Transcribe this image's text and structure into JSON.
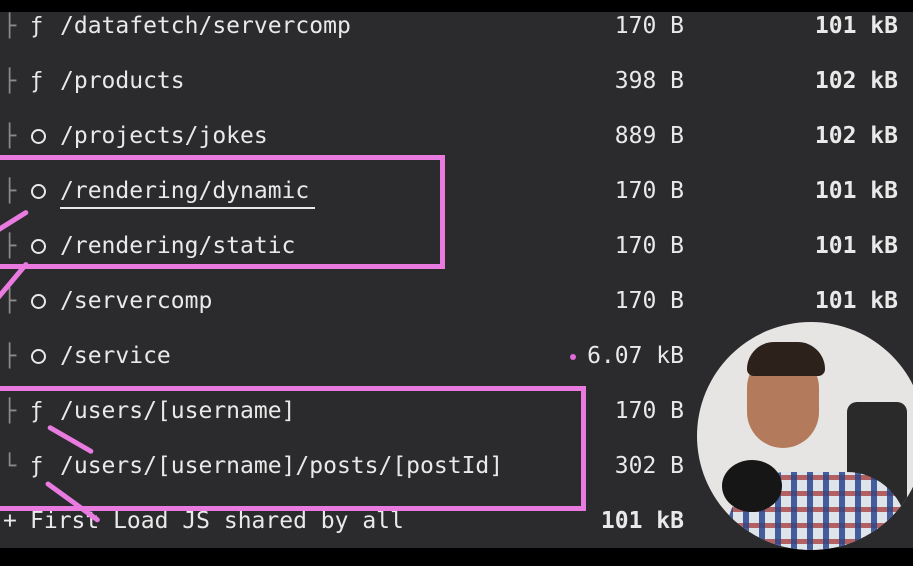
{
  "colors": {
    "annotation": "#e87ae0",
    "background": "#2b2b2d",
    "text": "#e9e9e9"
  },
  "rows": [
    {
      "symbol": "ƒ",
      "path": "/datafetch/servercomp",
      "size": "170 B",
      "first_load": "101 kB"
    },
    {
      "symbol": "ƒ",
      "path": "/products",
      "size": "398 B",
      "first_load": "102 kB"
    },
    {
      "symbol": "○",
      "path": "/projects/jokes",
      "size": "889 B",
      "first_load": "102 kB"
    },
    {
      "symbol": "○",
      "path": "/rendering/dynamic",
      "size": "170 B",
      "first_load": "101 kB"
    },
    {
      "symbol": "○",
      "path": "/rendering/static",
      "size": "170 B",
      "first_load": "101 kB"
    },
    {
      "symbol": "○",
      "path": "/servercomp",
      "size": "170 B",
      "first_load": "101 kB"
    },
    {
      "symbol": "○",
      "path": "/service",
      "size": "6.07 kB",
      "first_load": ""
    },
    {
      "symbol": "ƒ",
      "path": "/users/[username]",
      "size": "170 B",
      "first_load": ""
    },
    {
      "symbol": "ƒ",
      "path": "/users/[username]/posts/[postId]",
      "size": "302 B",
      "first_load": ""
    }
  ],
  "shared": {
    "prefix": "+",
    "label": "First Load JS shared by all",
    "value": "101 kB"
  }
}
